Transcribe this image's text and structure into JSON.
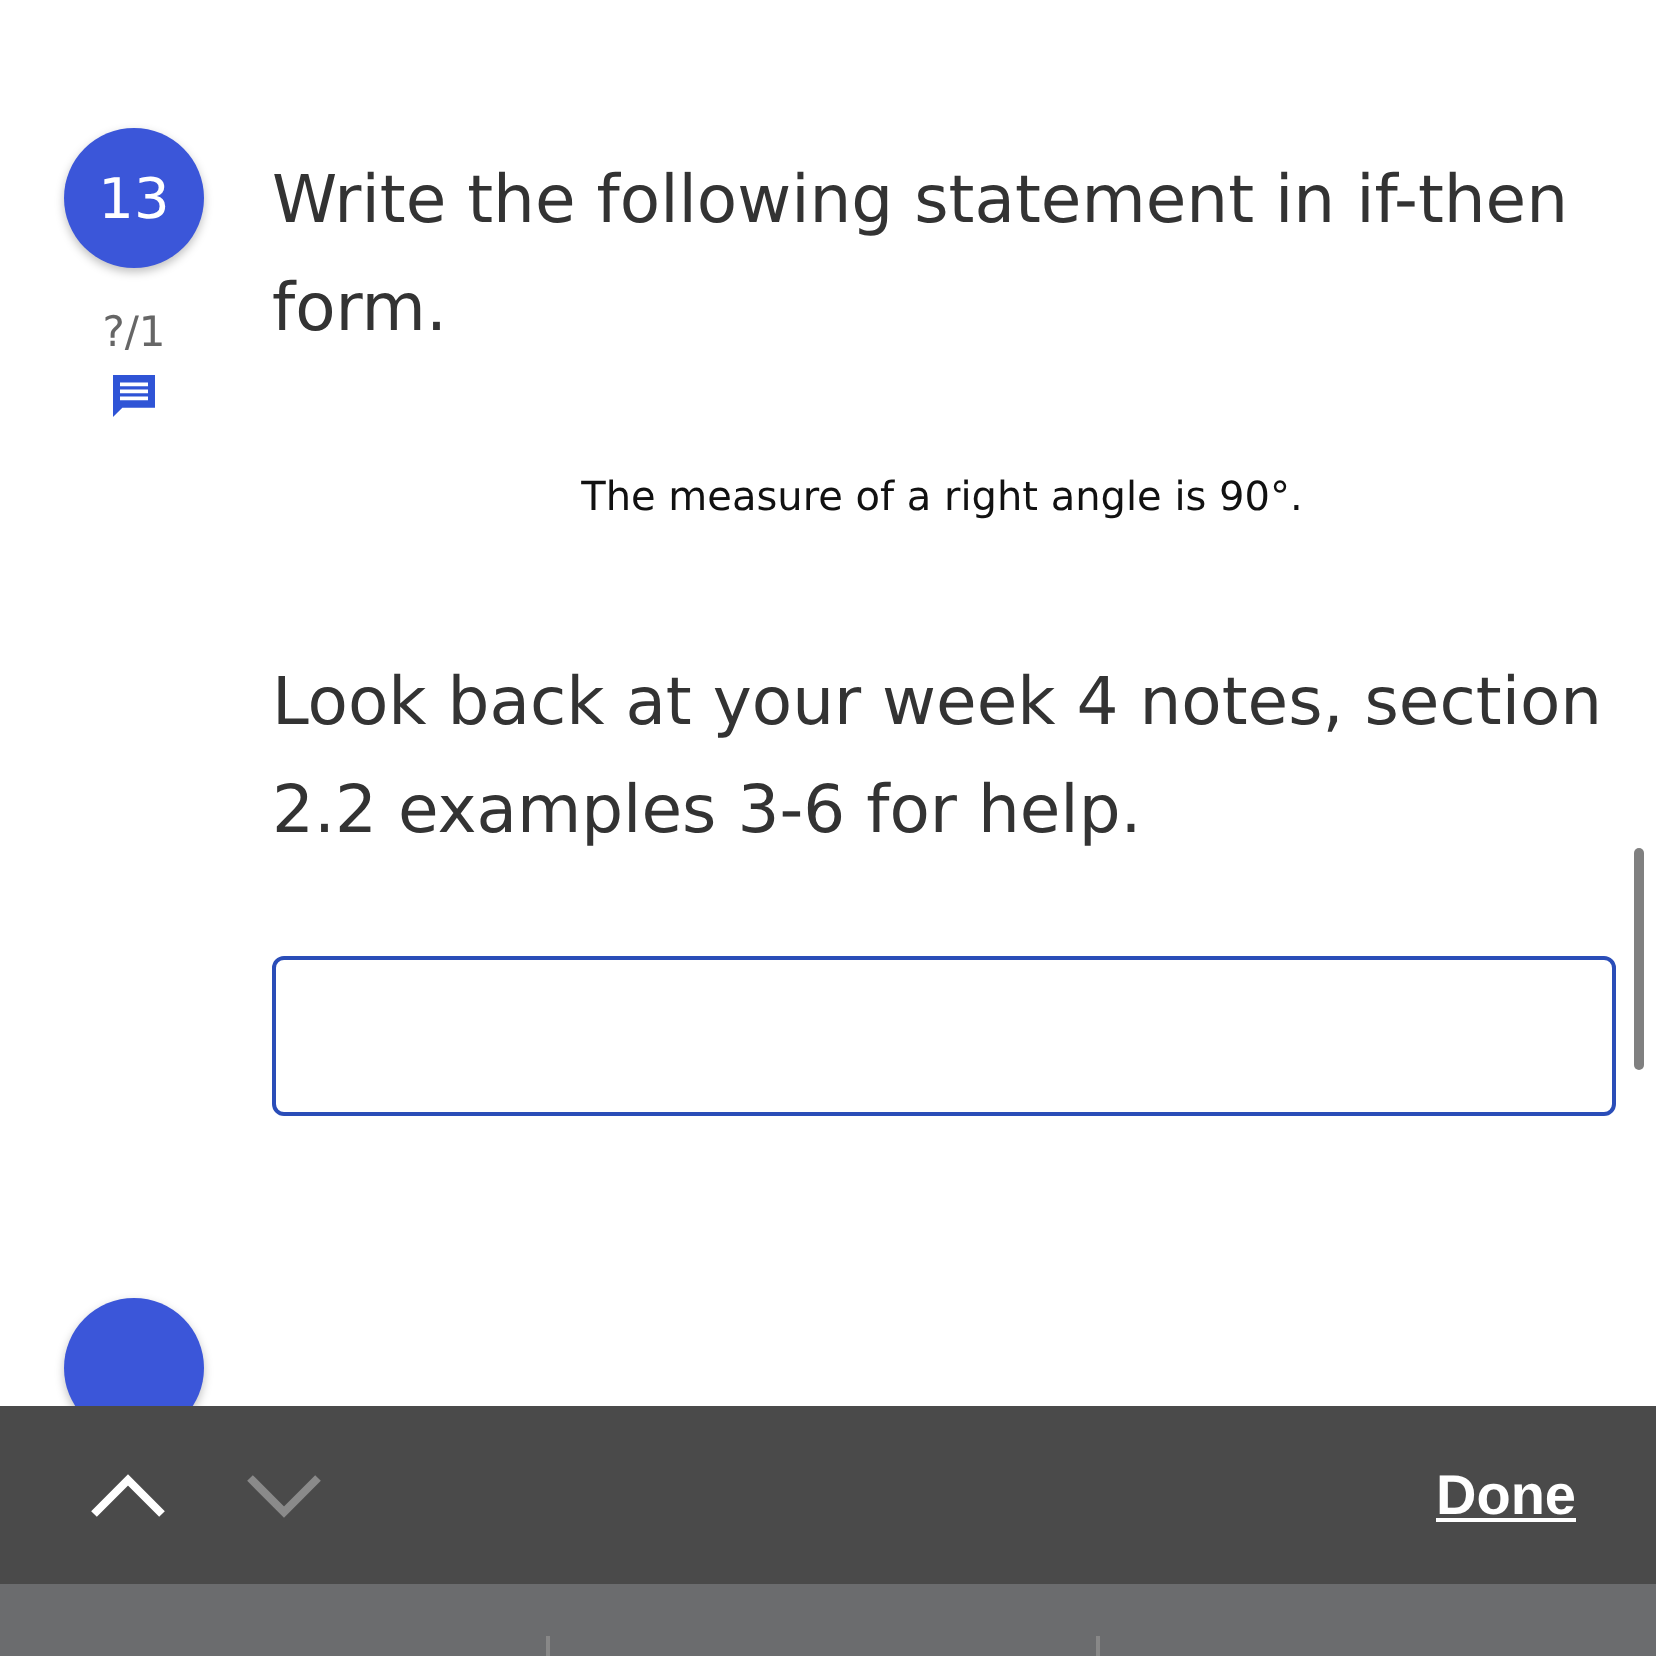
{
  "questions": [
    {
      "number": "13",
      "score": "?/1",
      "prompt": "Write the following statement in if-then form.",
      "statement": "The measure of a right angle is 90°.",
      "hint": "Look back at your week 4 notes, section 2.2 examples 3-6 for help.",
      "answer": {
        "kind": "text"
      }
    }
  ],
  "toolbar": {
    "previous": {
      "disabled": false
    },
    "next": {
      "disabled": true
    },
    "done": "Done"
  }
}
